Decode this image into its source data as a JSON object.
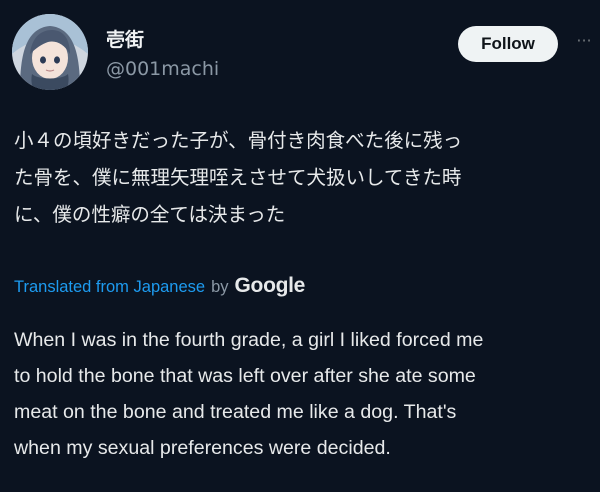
{
  "tweet": {
    "author": {
      "display_name": "壱街",
      "handle": "@001machi"
    },
    "follow_label": "Follow",
    "more_label": "···",
    "original_text": "小４の頃好きだった子が、骨付き肉食べた後に残っ\nた骨を、僕に無理矢理咥えさせて犬扱いしてきた時\nに、僕の性癖の全ては決まった",
    "translation_prefix": "Translated from Japanese",
    "translation_by": "by",
    "translation_provider": "Google",
    "translated_text": "When I was in the fourth grade, a girl I liked forced me\nto hold the bone that was left over after she ate some\nmeat on the bone and treated me like a dog. That's\nwhen my sexual preferences were decided."
  },
  "colors": {
    "background": "#0b1320",
    "text": "#e7e9ea",
    "muted": "#8b98a5",
    "link": "#1d9bf0",
    "button_bg": "#eff3f4"
  }
}
